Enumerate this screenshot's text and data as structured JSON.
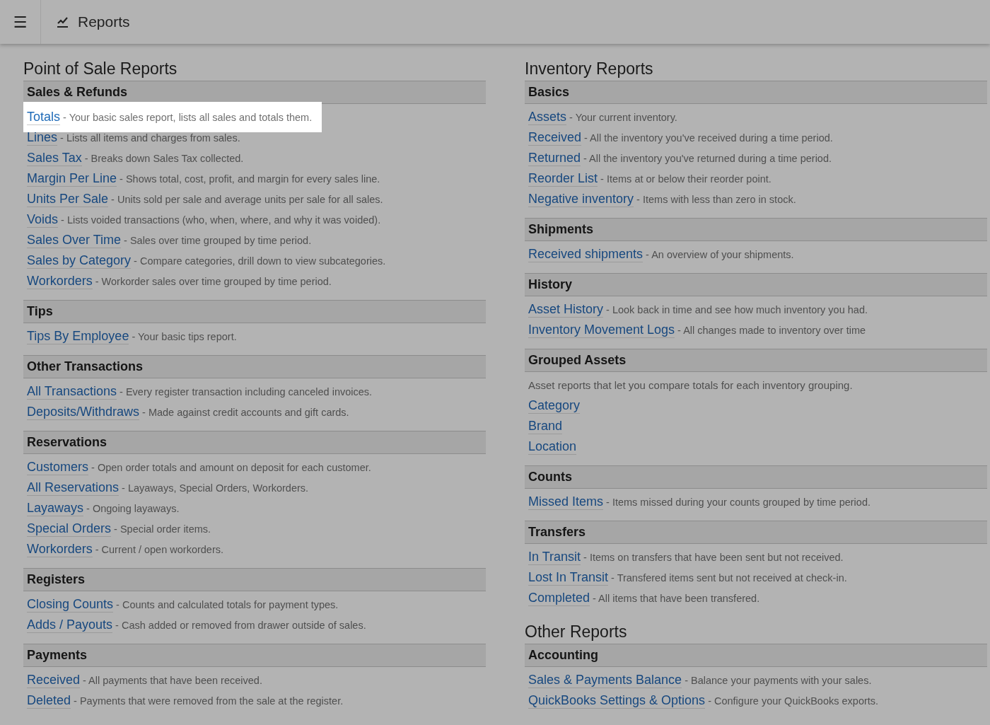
{
  "header": {
    "menu_icon": "☰",
    "title": "Reports"
  },
  "columns": [
    {
      "groups": [
        {
          "title": "Point of Sale Reports",
          "sections": [
            {
              "title": "Sales & Refunds",
              "items": [
                {
                  "link": "Totals",
                  "description": "- Your basic sales report, lists all sales and totals them.",
                  "highlighted": true
                },
                {
                  "link": "Lines",
                  "description": "- Lists all items and charges from sales.",
                  "highlighted": false
                },
                {
                  "link": "Sales Tax",
                  "description": "- Breaks down Sales Tax collected.",
                  "highlighted": false
                },
                {
                  "link": "Margin Per Line",
                  "description": "- Shows total, cost, profit, and margin for every sales line.",
                  "highlighted": false
                },
                {
                  "link": "Units Per Sale",
                  "description": "- Units sold per sale and average units per sale for all sales.",
                  "highlighted": false
                },
                {
                  "link": "Voids",
                  "description": "- Lists voided transactions (who, when, where, and why it was voided).",
                  "highlighted": false
                },
                {
                  "link": "Sales Over Time",
                  "description": "- Sales over time grouped by time period.",
                  "highlighted": false
                },
                {
                  "link": "Sales by Category",
                  "description": "- Compare categories, drill down to view subcategories.",
                  "highlighted": false
                },
                {
                  "link": "Workorders",
                  "description": "- Workorder sales over time grouped by time period.",
                  "highlighted": false
                }
              ]
            },
            {
              "title": "Tips",
              "items": [
                {
                  "link": "Tips By Employee",
                  "description": "- Your basic tips report.",
                  "highlighted": false
                }
              ]
            },
            {
              "title": "Other Transactions",
              "items": [
                {
                  "link": "All Transactions",
                  "description": "- Every register transaction including canceled invoices.",
                  "highlighted": false
                },
                {
                  "link": "Deposits/Withdraws",
                  "description": "- Made against credit accounts and gift cards.",
                  "highlighted": false
                }
              ]
            },
            {
              "title": "Reservations",
              "items": [
                {
                  "link": "Customers",
                  "description": "- Open order totals and amount on deposit for each customer.",
                  "highlighted": false
                },
                {
                  "link": "All Reservations",
                  "description": "- Layaways, Special Orders, Workorders.",
                  "highlighted": false
                },
                {
                  "link": "Layaways",
                  "description": "- Ongoing layaways.",
                  "highlighted": false
                },
                {
                  "link": "Special Orders",
                  "description": "- Special order items.",
                  "highlighted": false
                },
                {
                  "link": "Workorders",
                  "description": "- Current / open workorders.",
                  "highlighted": false
                }
              ]
            },
            {
              "title": "Registers",
              "items": [
                {
                  "link": "Closing Counts",
                  "description": "- Counts and calculated totals for payment types.",
                  "highlighted": false
                },
                {
                  "link": "Adds / Payouts",
                  "description": "- Cash added or removed from drawer outside of sales.",
                  "highlighted": false
                }
              ]
            },
            {
              "title": "Payments",
              "items": [
                {
                  "link": "Received",
                  "description": "- All payments that have been received.",
                  "highlighted": false
                },
                {
                  "link": "Deleted",
                  "description": "- Payments that were removed from the sale at the register.",
                  "highlighted": false
                }
              ]
            }
          ]
        }
      ]
    },
    {
      "groups": [
        {
          "title": "Inventory Reports",
          "sections": [
            {
              "title": "Basics",
              "items": [
                {
                  "link": "Assets",
                  "description": "- Your current inventory.",
                  "highlighted": false
                },
                {
                  "link": "Received",
                  "description": "- All the inventory you've received during a time period.",
                  "highlighted": false
                },
                {
                  "link": "Returned",
                  "description": "- All the inventory you've returned during a time period.",
                  "highlighted": false
                },
                {
                  "link": "Reorder List",
                  "description": "- Items at or below their reorder point.",
                  "highlighted": false
                },
                {
                  "link": "Negative inventory",
                  "description": "- Items with less than zero in stock.",
                  "highlighted": false
                }
              ]
            },
            {
              "title": "Shipments",
              "items": [
                {
                  "link": "Received shipments",
                  "description": "- An overview of your shipments.",
                  "highlighted": false
                }
              ]
            },
            {
              "title": "History",
              "items": [
                {
                  "link": "Asset History",
                  "description": "- Look back in time and see how much inventory you had.",
                  "highlighted": false
                },
                {
                  "link": "Inventory Movement Logs",
                  "description": "- All changes made to inventory over time",
                  "highlighted": false
                }
              ]
            },
            {
              "title": "Grouped Assets",
              "note": "Asset reports that let you compare totals for each inventory grouping.",
              "items": [
                {
                  "link": "Category",
                  "highlighted": false
                },
                {
                  "link": "Brand",
                  "highlighted": false
                },
                {
                  "link": "Location",
                  "highlighted": false
                }
              ]
            },
            {
              "title": "Counts",
              "items": [
                {
                  "link": "Missed Items",
                  "description": "- Items missed during your counts grouped by time period.",
                  "highlighted": false
                }
              ]
            },
            {
              "title": "Transfers",
              "items": [
                {
                  "link": "In Transit",
                  "description": "- Items on transfers that have been sent but not received.",
                  "highlighted": false
                },
                {
                  "link": "Lost In Transit",
                  "description": "- Transfered items sent but not received at check-in.",
                  "highlighted": false
                },
                {
                  "link": "Completed",
                  "description": "- All items that have been transfered.",
                  "highlighted": false
                }
              ]
            }
          ]
        },
        {
          "title": "Other Reports",
          "sections": [
            {
              "title": "Accounting",
              "items": [
                {
                  "link": "Sales & Payments Balance",
                  "description": "- Balance your payments with your sales.",
                  "highlighted": false
                },
                {
                  "link": "QuickBooks Settings & Options",
                  "description": "- Configure your QuickBooks exports.",
                  "highlighted": false
                }
              ]
            }
          ]
        }
      ]
    }
  ]
}
